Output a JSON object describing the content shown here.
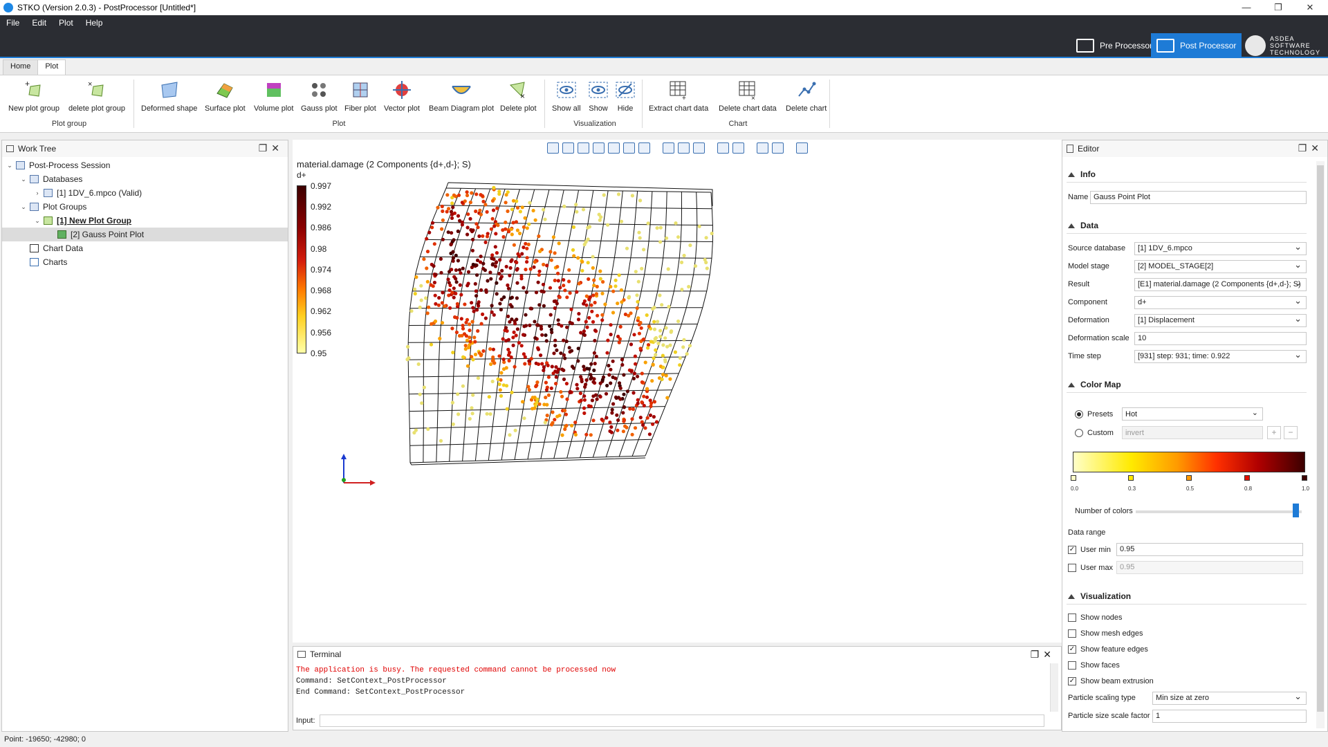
{
  "window": {
    "title": "STKO (Version 2.0.3) - PostProcessor [Untitled*]",
    "min": "—",
    "max": "❐",
    "close": "✕"
  },
  "menu": [
    "File",
    "Edit",
    "Plot",
    "Help"
  ],
  "modes": {
    "pre": "Pre Processor",
    "post": "Post Processor",
    "logo_line1": "ASDEA",
    "logo_line2": "SOFTWARE",
    "logo_line3": "TECHNOLOGY"
  },
  "tabs": [
    "Home",
    "Plot"
  ],
  "ribbon": {
    "buttons": [
      "New plot group",
      "delete plot group",
      "Deformed shape",
      "Surface plot",
      "Volume plot",
      "Gauss plot",
      "Fiber plot",
      "Vector plot",
      "Beam Diagram plot",
      "Delete plot",
      "Show all",
      "Show",
      "Hide",
      "Extract chart data",
      "Delete chart data",
      "Delete chart"
    ],
    "groups": [
      "Plot group",
      "Plot",
      "Visualization",
      "Chart"
    ]
  },
  "worktree": {
    "title": "Work Tree",
    "items": [
      "Post-Process Session",
      "Databases",
      "[1] 1DV_6.mpco (Valid)",
      "Plot Groups",
      "[1] New Plot Group",
      "[2] Gauss Point Plot",
      "Chart Data",
      "Charts"
    ]
  },
  "viewport": {
    "result_title": "material.damage (2 Components {d+,d-}; S)",
    "component": "d+",
    "legend_ticks": [
      "0.997",
      "0.992",
      "0.986",
      "0.98",
      "0.974",
      "0.968",
      "0.962",
      "0.956",
      "0.95"
    ]
  },
  "terminal": {
    "title": "Terminal",
    "lines": [
      "The application is busy. The requested command cannot be processed now",
      "Command: SetContext_PostProcessor",
      "End Command: SetContext_PostProcessor"
    ],
    "input_label": "Input:"
  },
  "editor": {
    "title": "Editor",
    "info_section": "Info",
    "name_label": "Name",
    "name_value": "Gauss Point Plot",
    "data_section": "Data",
    "fields": [
      {
        "label": "Source database",
        "value": "[1] 1DV_6.mpco"
      },
      {
        "label": "Model stage",
        "value": "[2] MODEL_STAGE[2]"
      },
      {
        "label": "Result",
        "value": "[E1] material.damage (2 Components {d+,d-}; S)"
      },
      {
        "label": "Component",
        "value": "d+"
      },
      {
        "label": "Deformation",
        "value": "[1] Displacement"
      },
      {
        "label": "Deformation scale",
        "value": "10"
      },
      {
        "label": "Time step",
        "value": "[931] step: 931; time: 0.922"
      }
    ],
    "colormap_section": "Color Map",
    "presets_label": "Presets",
    "presets_value": "Hot",
    "custom_label": "Custom",
    "custom_value": "invert",
    "cmap_labels": [
      "0.0",
      "0.3",
      "0.5",
      "0.8",
      "1.0"
    ],
    "num_colors_label": "Number of colors",
    "data_range_label": "Data range",
    "user_min_label": "User min",
    "user_min_value": "0.95",
    "user_max_label": "User max",
    "user_max_value": "0.95",
    "vis_section": "Visualization",
    "checks": [
      {
        "label": "Show nodes",
        "on": false
      },
      {
        "label": "Show mesh edges",
        "on": false
      },
      {
        "label": "Show feature edges",
        "on": true
      },
      {
        "label": "Show faces",
        "on": false
      },
      {
        "label": "Show beam extrusion",
        "on": true
      }
    ],
    "scaling_label": "Particle scaling type",
    "scaling_value": "Min size at zero",
    "size_factor_label": "Particle size scale factor",
    "size_factor_value": "1"
  },
  "status": "Point: -19650; -42980; 0"
}
